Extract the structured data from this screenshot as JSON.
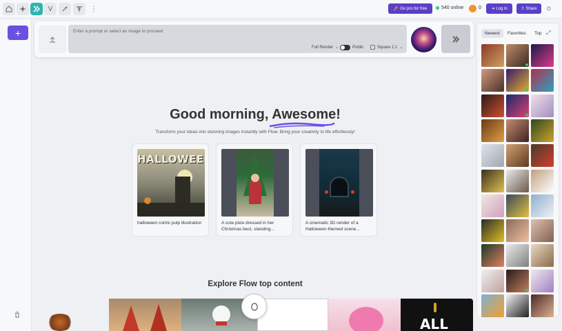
{
  "topbar": {
    "pro_label": "Go pro for free",
    "online_text": "540 online",
    "coins": "0",
    "login_label": "Log in",
    "share_label": "Share",
    "v_label": "V"
  },
  "prompt": {
    "placeholder": "Enter a prompt or select an image to proceed",
    "render_mode": "Full Render",
    "public_label": "Public",
    "aspect_label": "Square 1:1"
  },
  "main": {
    "greeting_prefix": "Good morning,",
    "greeting_name": "Awesome!",
    "subtitle": "Transform your ideas into stunning images instantly with Flow. Bring your creativity to life effortlessly!",
    "cards": [
      {
        "caption": "halloween comic pulp illustration",
        "image_text": "HALLOWEEN"
      },
      {
        "caption": "A cute pixie dressed in her Christmas best, standing..."
      },
      {
        "caption": "A cinematic 3D render of a Halloween-themed scene..."
      }
    ],
    "explore_title": "Explore Flow top content",
    "strip_text": "ALL"
  },
  "gallery": {
    "tabs": [
      "Newest",
      "Favorites",
      "Top"
    ]
  },
  "colors": {
    "accent": "#5a3fc8",
    "teal": "#2fb5b0",
    "online": "#2ecc71"
  }
}
